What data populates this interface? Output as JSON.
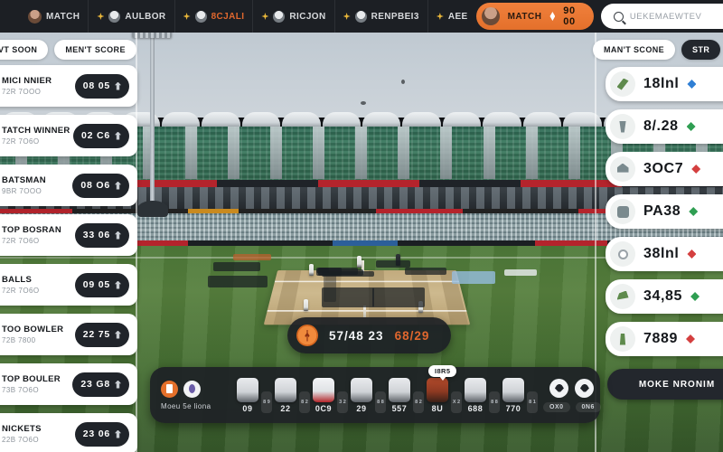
{
  "topnav": {
    "menu_icon": "hamburger-icon",
    "brand_label": "MATCH",
    "items": [
      {
        "label": "AULBOR",
        "icon": "spark-icon",
        "alert": false
      },
      {
        "label": "8CJALI",
        "icon": "spark-icon",
        "alert": true
      },
      {
        "label": "RICJON",
        "icon": "spark-icon",
        "alert": false
      },
      {
        "label": "RENPBEI3",
        "icon": "spark-icon",
        "alert": false
      },
      {
        "label": "AEE",
        "icon": "spark-icon",
        "alert": false
      }
    ],
    "balance": {
      "label": "MATCH",
      "currency_icon": "diamond-icon",
      "amount": "90 00",
      "color": "#e4702b"
    },
    "search": {
      "icon": "search-icon",
      "placeholder": "UEKEMAEWTEV"
    }
  },
  "left_panel": {
    "chips": [
      "VT SOON",
      "MEN'T SCORE"
    ],
    "markets": [
      {
        "title": "MICI NNIER",
        "sub": "72R 7OOO",
        "odds": "08 05",
        "icon": "trophy-icon"
      },
      {
        "title": "TATCH WINNER",
        "sub": "72R 7O6O",
        "odds": "02 C6",
        "icon": "trophy-icon"
      },
      {
        "title": "BATSMAN",
        "sub": "9BR 7OOO",
        "odds": "08 O6",
        "icon": "bat-icon"
      },
      {
        "title": "TOP BOSRAN",
        "sub": "72R 7O6O",
        "odds": "33 06",
        "icon": "bat-icon"
      },
      {
        "title": "BALLS",
        "sub": "72R 7O6O",
        "odds": "09 05",
        "icon": "ball-icon"
      },
      {
        "title": "TOO BOWLER",
        "sub": "72B 7800",
        "odds": "22 75",
        "icon": "ball-icon"
      },
      {
        "title": "TOP BOULER",
        "sub": "73B 7O6O",
        "odds": "23 G8",
        "icon": "ball-icon"
      },
      {
        "title": "NICKETS",
        "sub": "22B 7O6O",
        "odds": "23 06",
        "icon": "wicket-icon"
      }
    ]
  },
  "right_panel": {
    "chips": [
      {
        "label": "MAN'T SCONE",
        "dark": false
      },
      {
        "label": "STR",
        "dark": true
      }
    ],
    "stats": [
      {
        "value": "18lnl",
        "icon": "bat-icon",
        "icon_color": "#5e8a4c",
        "trend": "up",
        "trend_color": "#2f7fd4"
      },
      {
        "value": "8/.28",
        "icon": "wicket-icon",
        "icon_color": "#7a8a8e",
        "trend": "up",
        "trend_color": "#2f9e52"
      },
      {
        "value": "3OC7",
        "icon": "helmet-icon",
        "icon_color": "#7a8a8e",
        "trend": "down",
        "trend_color": "#d43f3f"
      },
      {
        "value": "PA38",
        "icon": "glove-icon",
        "icon_color": "#7a8a8e",
        "trend": "up",
        "trend_color": "#2f9e52"
      },
      {
        "value": "38lnl",
        "icon": "ball-icon",
        "icon_color": "#9aa2a8",
        "trend": "down",
        "trend_color": "#d43f3f"
      },
      {
        "value": "34,85",
        "icon": "cap-icon",
        "icon_color": "#5e8a4c",
        "trend": "up",
        "trend_color": "#2f9e52"
      },
      {
        "value": "7889",
        "icon": "stump-icon",
        "icon_color": "#5e8a4c",
        "trend": "down",
        "trend_color": "#d43f3f"
      }
    ],
    "more_label": "MOKE NRONIM"
  },
  "score_overlay": {
    "avatar_icon": "player-icon",
    "main": "57/48 23",
    "alt": "68/29"
  },
  "bottom_bar": {
    "left_label": "Moeu 5e liona",
    "icon_primary": "bat-toggle-icon",
    "icon_secondary": "stats-toggle-icon",
    "players": [
      {
        "num": "09",
        "kit": "light"
      },
      {
        "num": "22",
        "kit": "light"
      },
      {
        "num": "0C9",
        "kit": "red"
      },
      {
        "num": "29",
        "kit": "light"
      },
      {
        "num": "557",
        "kit": "light"
      },
      {
        "num": "8U",
        "kit": "dark"
      },
      {
        "num": "688",
        "kit": "light"
      },
      {
        "num": "770",
        "kit": "light"
      }
    ],
    "mini_pills": [
      "8 9",
      "8 2",
      "3 2",
      "8 8",
      "8 2",
      "X 2",
      "8 8",
      "8 1"
    ],
    "tooltip": "I8R5",
    "right_buttons": [
      "shield-icon",
      "shield-icon"
    ],
    "right_pills": [
      "OX0",
      "0N6"
    ]
  }
}
